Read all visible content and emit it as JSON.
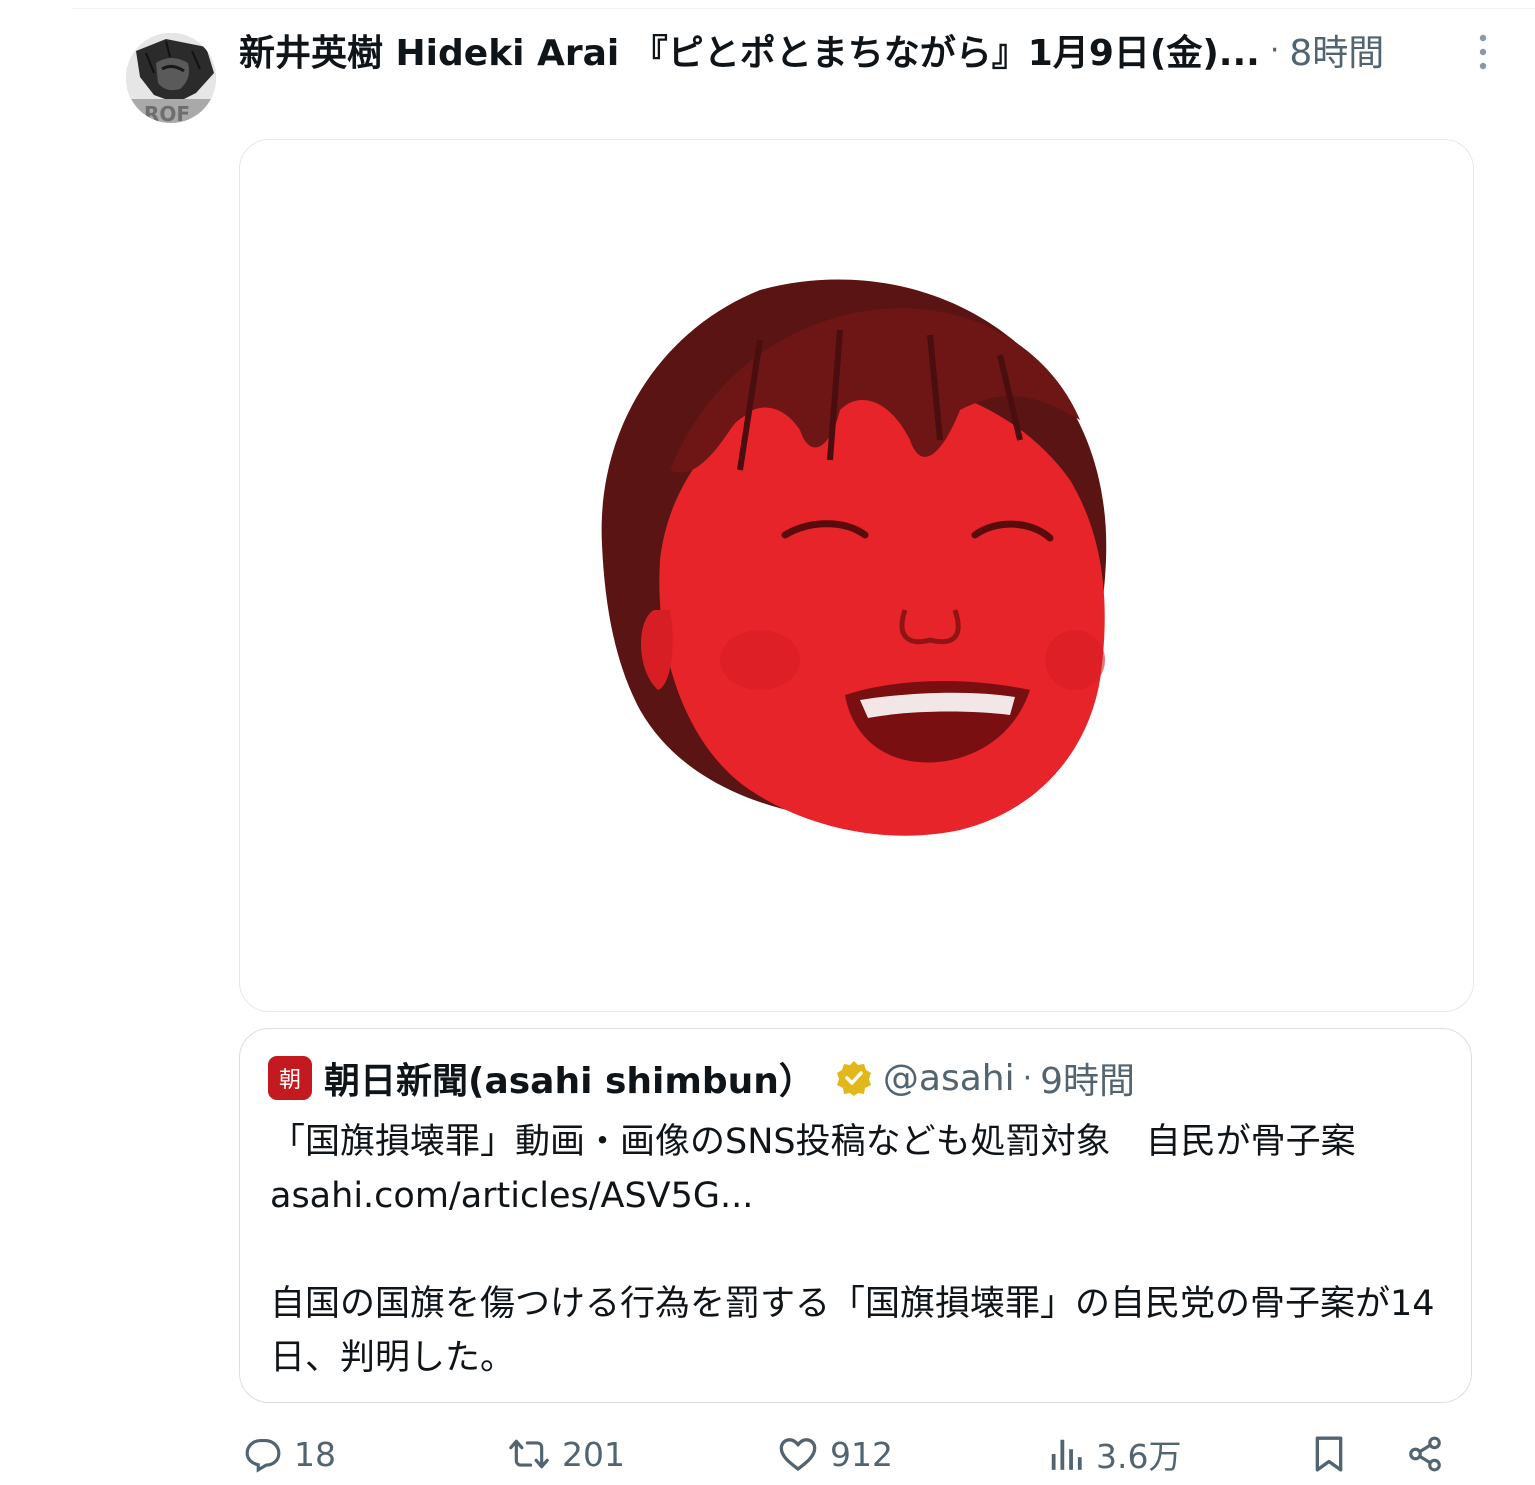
{
  "tweet": {
    "display_name": "新井英樹 Hideki Arai 『ピとポとまちながら』1月9日(金)...",
    "separator": "·",
    "time": "8時間",
    "avatar_icon": "manga-avatar-icon",
    "more_icon": "more-vertical-icon"
  },
  "media": {
    "description_icon": "red-face-image"
  },
  "quote": {
    "logo_text": "朝",
    "name": "朝日新聞(asahi shimbun）",
    "verified_icon": "verified-gold-badge-icon",
    "handle": "@asahi",
    "separator": "·",
    "time": "9時間",
    "text_line1": "「国旗損壊罪」動画・画像のSNS投稿なども処罰対象　自民が骨子案 asahi.com/articles/ASV5G...",
    "text_line2": "自国の国旗を傷つける行為を罰する「国旗損壊罪」の自民党の骨子案が14日、判明した。"
  },
  "actions": {
    "reply_count": "18",
    "retweet_count": "201",
    "like_count": "912",
    "views_count": "3.6万",
    "icons": [
      "reply-icon",
      "retweet-icon",
      "like-icon",
      "views-icon",
      "bookmark-icon",
      "share-icon"
    ]
  },
  "colors": {
    "text_primary": "#0f1419",
    "text_secondary": "#536471",
    "border": "#dadfe1",
    "asahi_red": "#c3191f",
    "verified_gold": "#e2b719",
    "face_red": "#e8242b"
  }
}
